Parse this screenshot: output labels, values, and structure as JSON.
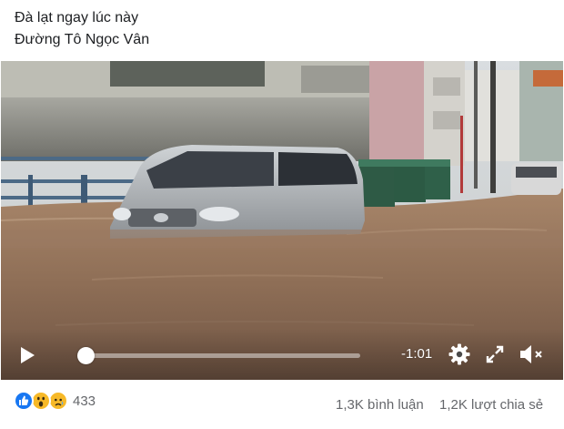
{
  "post": {
    "line1": "Đà lạt ngay lúc này",
    "line2": "Đường Tô Ngọc Vân"
  },
  "video": {
    "remaining_time": "-1:01",
    "progress_fraction": 0.0,
    "icons": {
      "play": "play-icon",
      "settings": "gear-icon",
      "fullscreen": "expand-icon",
      "volume": "volume-muted-icon"
    }
  },
  "engagement": {
    "reactions": [
      "like",
      "wow",
      "sad"
    ],
    "reaction_count": "433",
    "comments": "1,3K bình luận",
    "shares": "1,2K lượt chia sẻ"
  },
  "colors": {
    "like_blue": "#1877f2",
    "emoji_yellow": "#f7b928",
    "secondary_text": "#65676b"
  }
}
